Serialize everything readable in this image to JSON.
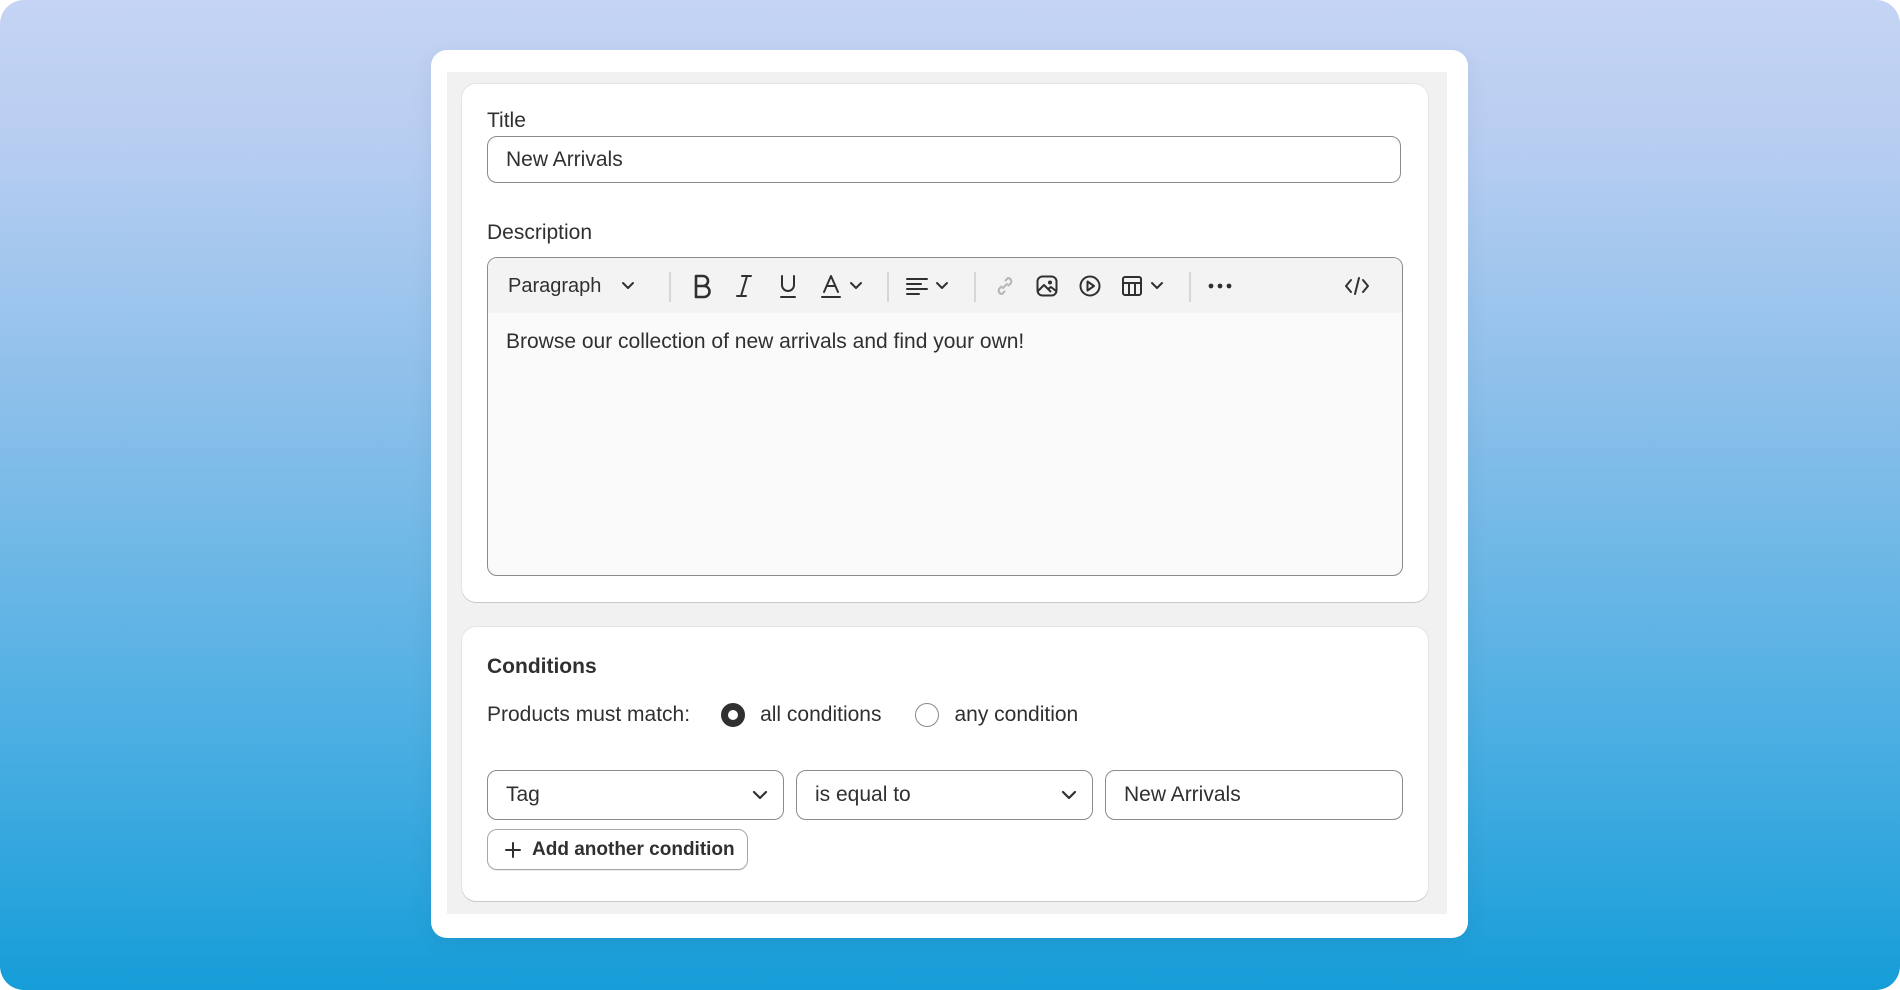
{
  "title_field": {
    "label": "Title",
    "value": "New Arrivals"
  },
  "description_field": {
    "label": "Description",
    "content": "Browse our collection of new arrivals and find your own!",
    "toolbar": {
      "paragraph_label": "Paragraph",
      "icons": [
        "bold-icon",
        "italic-icon",
        "underline-icon",
        "text-color-icon",
        "align-icon",
        "link-icon",
        "image-icon",
        "video-icon",
        "table-icon",
        "more-icon",
        "code-icon"
      ]
    }
  },
  "conditions": {
    "title": "Conditions",
    "match_label": "Products must match:",
    "options": [
      {
        "label": "all conditions",
        "selected": true
      },
      {
        "label": "any condition",
        "selected": false
      }
    ],
    "rule": {
      "field": "Tag",
      "operator": "is equal to",
      "value": "New Arrivals"
    },
    "add_button_label": "Add another condition"
  }
}
